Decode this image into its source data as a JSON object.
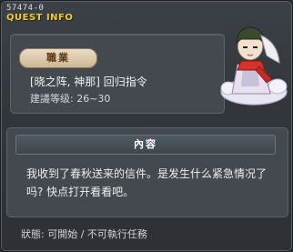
{
  "quest": {
    "id": "57474-0",
    "info_title": "QUEST INFO",
    "job_label": "職業",
    "name": "[晓之阵, 神那] 回归指令",
    "level": "建議等级: 26~30"
  },
  "content": {
    "header": "內容",
    "text": "我收到了春秋送来的信件。是发生什么紧急情况了吗? 快点打开看看吧。"
  },
  "status": {
    "text": "狀態: 可開始 / 不可執行任務"
  },
  "colors": {
    "title_accent": "#f0c93a",
    "badge_bg": "#e0d0b2",
    "panel_bg": "#44494f"
  }
}
